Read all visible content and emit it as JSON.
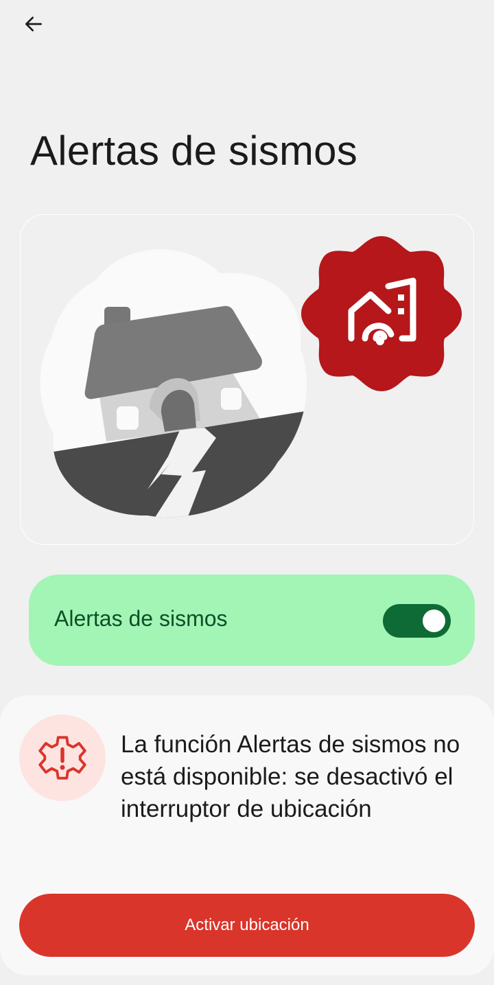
{
  "header": {
    "back_icon": "arrow-left-icon",
    "title": "Alertas de sismos"
  },
  "illustration": {
    "icons": [
      "cracked-house-icon",
      "earthquake-alert-badge-icon"
    ],
    "badge_color": "#b5171a"
  },
  "toggle": {
    "label": "Alertas de sismos",
    "state": "on",
    "track_color": "#0f6b35",
    "background_color": "#a3f5b5"
  },
  "warning": {
    "icon": "settings-alert-icon",
    "message": "La función Alertas de sismos no está disponible: se desactivó el interruptor de ubicación",
    "button_label": "Activar ubicación",
    "accent_color": "#d9352b"
  }
}
